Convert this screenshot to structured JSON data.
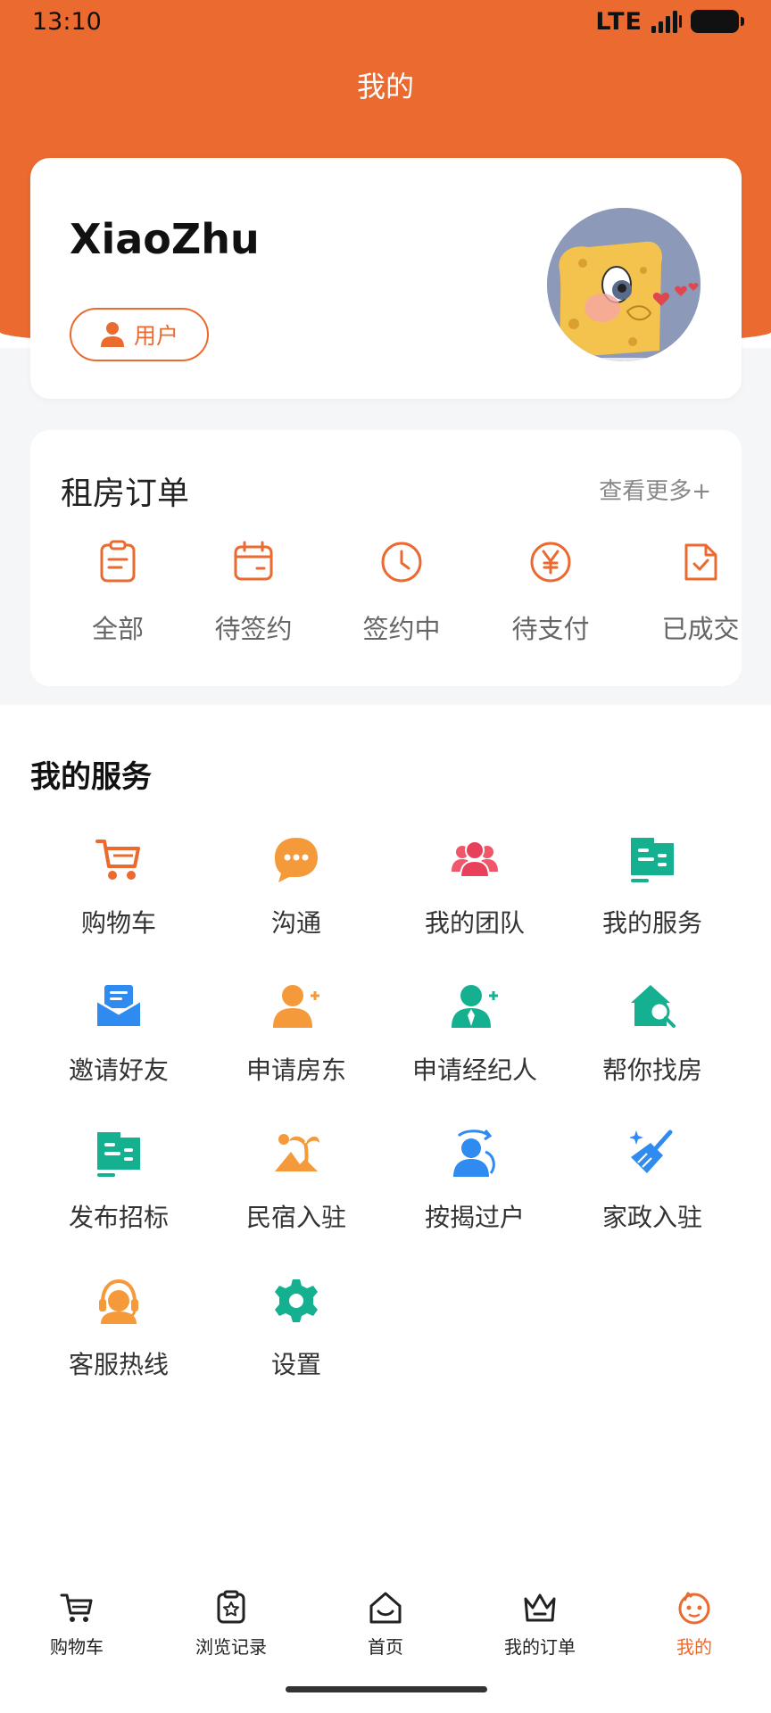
{
  "colors": {
    "brand": "#EA6A30",
    "bg_gray": "#F5F6F8",
    "teal": "#14B08F",
    "blue": "#2F8BF0",
    "orange": "#F59A3A"
  },
  "status_bar": {
    "time": "13:10",
    "network": "LTE"
  },
  "header": {
    "title": "我的"
  },
  "profile": {
    "username": "XiaoZhu",
    "role_label": "用户",
    "role_icon": "user-icon"
  },
  "orders": {
    "title": "租房订单",
    "more_label": "查看更多+",
    "items": [
      {
        "label": "全部",
        "icon": "clipboard-icon"
      },
      {
        "label": "待签约",
        "icon": "calendar-icon"
      },
      {
        "label": "签约中",
        "icon": "clock-icon"
      },
      {
        "label": "待支付",
        "icon": "yen-icon"
      },
      {
        "label": "已成交",
        "icon": "file-check-icon"
      }
    ]
  },
  "services": {
    "title": "我的服务",
    "items": [
      {
        "label": "购物车",
        "icon": "cart-icon"
      },
      {
        "label": "沟通",
        "icon": "chat-icon"
      },
      {
        "label": "我的团队",
        "icon": "team-icon"
      },
      {
        "label": "我的服务",
        "icon": "service-list-icon"
      },
      {
        "label": "邀请好友",
        "icon": "mail-icon"
      },
      {
        "label": "申请房东",
        "icon": "user-add-icon"
      },
      {
        "label": "申请经纪人",
        "icon": "agent-add-icon"
      },
      {
        "label": "帮你找房",
        "icon": "house-search-icon"
      },
      {
        "label": "发布招标",
        "icon": "publish-icon"
      },
      {
        "label": "民宿入驻",
        "icon": "island-icon"
      },
      {
        "label": "按揭过户",
        "icon": "transfer-icon"
      },
      {
        "label": "家政入驻",
        "icon": "broom-icon"
      },
      {
        "label": "客服热线",
        "icon": "headset-icon"
      },
      {
        "label": "设置",
        "icon": "gear-icon"
      }
    ]
  },
  "tabbar": {
    "items": [
      {
        "label": "购物车",
        "icon": "cart-icon"
      },
      {
        "label": "浏览记录",
        "icon": "history-icon"
      },
      {
        "label": "首页",
        "icon": "home-icon"
      },
      {
        "label": "我的订单",
        "icon": "order-icon"
      },
      {
        "label": "我的",
        "icon": "profile-icon",
        "active": true
      }
    ]
  }
}
